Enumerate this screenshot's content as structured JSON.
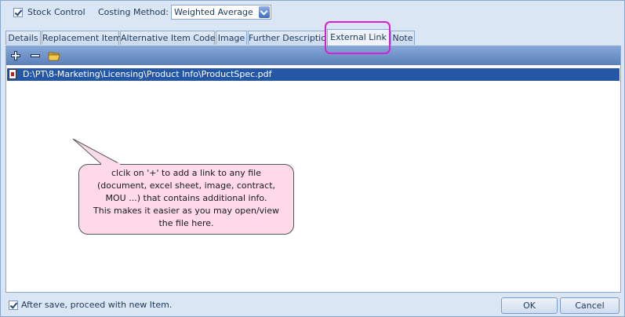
{
  "top": {
    "stock_control_label": "Stock Control",
    "costing_method_label": "Costing Method:",
    "costing_method_value": "Weighted Average"
  },
  "tabs": [
    {
      "label": "Details"
    },
    {
      "label": "Replacement Item"
    },
    {
      "label": "Alternative Item Code"
    },
    {
      "label": "Image"
    },
    {
      "label": "Further Description"
    },
    {
      "label": "External Link"
    },
    {
      "label": "Note"
    }
  ],
  "active_tab": "External Link",
  "toolbar": {
    "add_icon": "plus-icon",
    "remove_icon": "minus-icon",
    "open_icon": "folder-open-icon"
  },
  "links": [
    {
      "path": "D:\\PT\\8-Marketing\\Licensing\\Product Info\\ProductSpec.pdf"
    }
  ],
  "callout": {
    "lines": [
      "clcik on '+' to add a link to any file",
      "(document, excel sheet,  image, contract,",
      "MOU ...) that contains additional info.",
      "This makes it easier as you may open/view",
      "the file here."
    ]
  },
  "footer": {
    "proceed_label": "After save, proceed with new Item.",
    "ok_label": "OK",
    "cancel_label": "Cancel"
  },
  "colors": {
    "selection": "#2458a6",
    "highlight_border": "#d41fd4",
    "callout_fill": "#fdd9ea"
  }
}
